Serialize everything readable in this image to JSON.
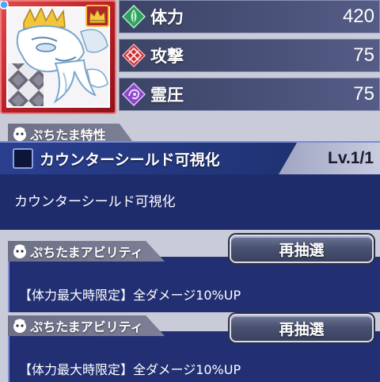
{
  "character": {
    "portrait_label": "white-dragon-king-portrait"
  },
  "stats": [
    {
      "label": "体力",
      "value": "420",
      "icon": "leaf-icon",
      "color": "#3dbf72"
    },
    {
      "label": "攻撃",
      "value": "75",
      "icon": "attack-crystal-icon",
      "color": "#d8343d"
    },
    {
      "label": "霊圧",
      "value": "75",
      "icon": "spirit-pressure-icon",
      "color": "#a060d8"
    }
  ],
  "trait": {
    "section_label": "ぷちたま特性",
    "name": "カウンターシールド可視化",
    "level": "Lv.1/1",
    "description": "カウンターシールド可視化"
  },
  "abilities": [
    {
      "section_label": "ぷちたまアビリティ",
      "button_label": "再抽選",
      "text": "【体力最大時限定】全ダメージ10%UP"
    },
    {
      "section_label": "ぷちたまアビリティ",
      "button_label": "再抽選",
      "text": "【体力最大時限定】全ダメージ10%UP"
    }
  ],
  "colors": {
    "panel": "#1f2c6c",
    "stat_bar": "#3b4366",
    "portrait_frame": "#b81f26"
  }
}
